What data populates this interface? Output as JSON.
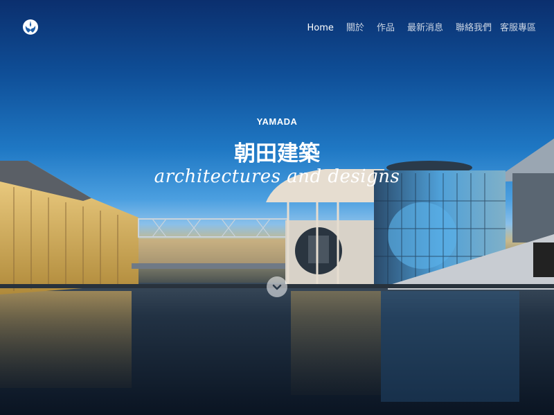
{
  "nav": {
    "items": [
      {
        "label": "Home",
        "active": true
      },
      {
        "label": "關於",
        "active": false
      },
      {
        "label": "作品",
        "active": false
      },
      {
        "label": "最新消息",
        "active": false
      },
      {
        "label": "聯絡我們",
        "active": false
      },
      {
        "label": "客服專區",
        "active": false
      }
    ]
  },
  "logo": {
    "icon": "rebel-alliance-icon"
  },
  "hero": {
    "kicker": "YAMADA",
    "title": "朝田建築",
    "tagline": "architectures and designs"
  },
  "scroll": {
    "icon": "chevron-down-icon"
  }
}
